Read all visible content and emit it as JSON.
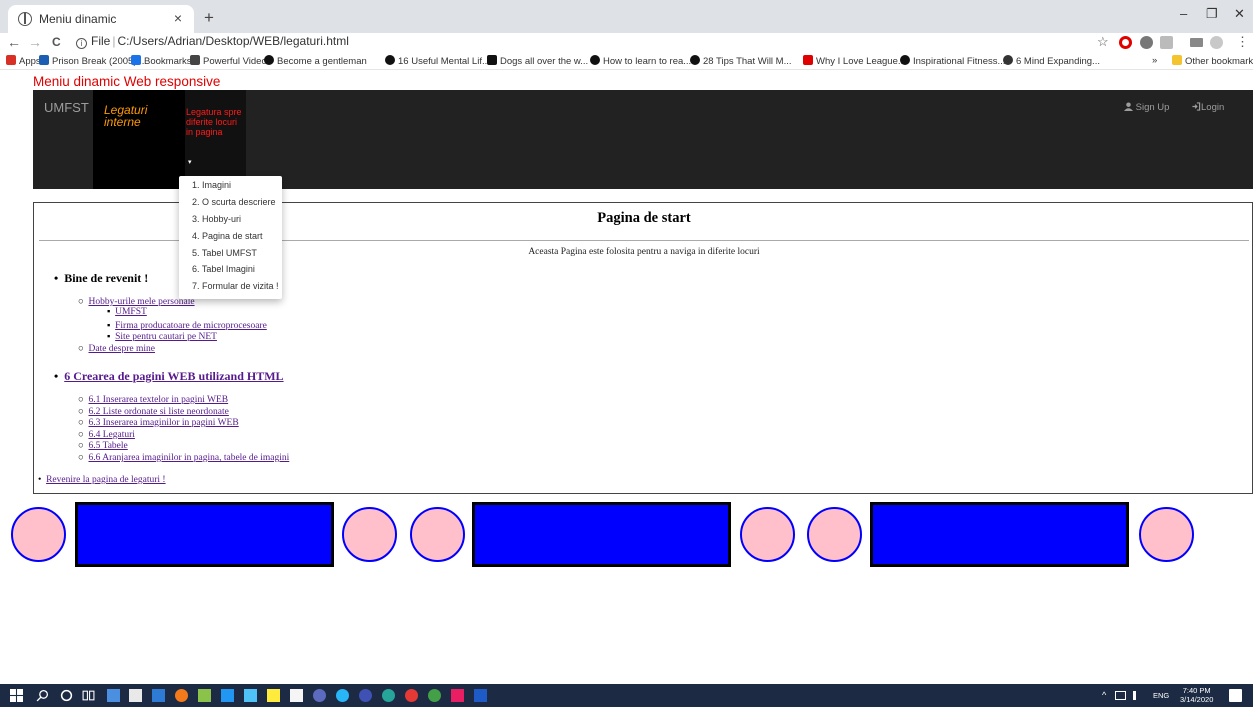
{
  "browser": {
    "tab_title": "Meniu dinamic",
    "tab_close": "×",
    "new_tab": "+",
    "win_min": "–",
    "win_max": "❐",
    "win_close": "✕",
    "back": "←",
    "forward": "→",
    "reload": "C",
    "url_prefix": "File",
    "url": "C:/Users/Adrian/Desktop/WEB/legaturi.html",
    "star": "☆",
    "menu": "⋮"
  },
  "bookmarks": [
    {
      "label": "Apps",
      "icon": "apps-grid-icon",
      "color": "#d93025"
    },
    {
      "label": "Prison Break (2005)...",
      "icon": "imdb-icon",
      "color": "#1a5fb4"
    },
    {
      "label": "Bookmarks",
      "icon": "star-icon",
      "color": "#1a73e8"
    },
    {
      "label": "Powerful Video",
      "icon": "lightbulb-icon",
      "color": "#444444"
    },
    {
      "label": "Become a gentleman",
      "icon": "quote-icon",
      "color": "#111111"
    },
    {
      "label": "16 Useful Mental Lif...",
      "icon": "quote-icon",
      "color": "#111111"
    },
    {
      "label": "Dogs all over the w...",
      "icon": "quote-icon",
      "color": "#111111"
    },
    {
      "label": "How to learn to rea...",
      "icon": "quote-icon",
      "color": "#111111"
    },
    {
      "label": "28 Tips That Will M...",
      "icon": "quote-icon",
      "color": "#111111"
    },
    {
      "label": "Why I Love League...",
      "icon": "youtube-icon",
      "color": "#e00000"
    },
    {
      "label": "Inspirational Fitness...",
      "icon": "quote-icon",
      "color": "#111111"
    },
    {
      "label": "6 Mind Expanding...",
      "icon": "globe-icon",
      "color": "#333333"
    }
  ],
  "bookmarks_more": "»",
  "other_bookmarks": "Other bookmarks",
  "page": {
    "heading": "Meniu dinamic Web responsive",
    "navbar": {
      "brand": "UMFST",
      "links_label": "Legaturi interne",
      "dropdown_label": "Legatura spre diferite locuri in pagina",
      "caret": "▾",
      "signup": "Sign Up",
      "login": "Login"
    },
    "dropdown_items": [
      "1. Imagini",
      "2. O scurta descriere",
      "3. Hobby-uri",
      "4. Pagina de start",
      "5. Tabel UMFST",
      "6. Tabel Imagini",
      "7. Formular de vizita !"
    ],
    "content": {
      "title": "Pagina de start",
      "subtitle": "Aceasta Pagina este folosita pentru a naviga in diferite locuri",
      "welcome": "Bine de revenit !",
      "hobby_link": "Hobby-urile mele personale",
      "hobby_items": [
        "UMFST",
        "Firma producatoare de microprocesoare",
        "Site pentru cautari pe NET"
      ],
      "about_link": "Date despre mine",
      "course_link": "6 Crearea de pagini WEB utilizand HTML",
      "course_items": [
        "6.1 Inserarea textelor in pagini WEB",
        "6.2 Liste ordonate si liste neordonate",
        "6.3 Inserarea imaginilor in pagini WEB",
        "6.4 Legaturi",
        "6.5 Tabele",
        "6.6 Aranjarea imaginilor in pagina, tabele de imagini"
      ],
      "back_link": "Revenire la pagina de legaturi !"
    }
  },
  "taskbar": {
    "lang": "ENG",
    "time": "7:40 PM",
    "date": "3/14/2020"
  },
  "colors": {
    "heading_red": "#e00000",
    "navbar_bg": "#222222",
    "link_orange": "#ff9900",
    "shape_pink": "#ffc0cb",
    "shape_blue": "#0000ff"
  }
}
